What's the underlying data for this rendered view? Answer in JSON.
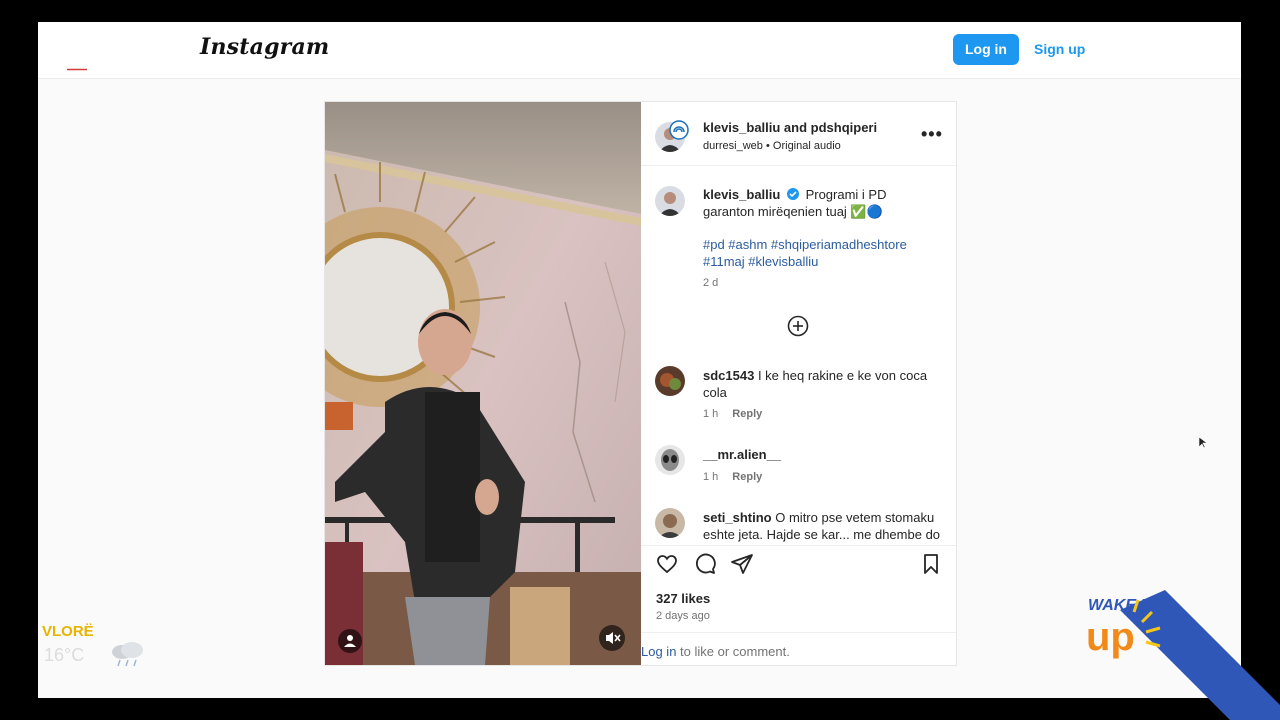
{
  "app": {
    "logo": "Instagram"
  },
  "header": {
    "login_label": "Log in",
    "signup_label": "Sign up"
  },
  "post": {
    "header_user": "klevis_balliu and pdshqiperi",
    "header_subuser": "durresi_web",
    "header_audio": "Original audio",
    "more_label": "•••",
    "caption": {
      "user": "klevis_balliu",
      "text": "Programi i PD garanton mirëqenien tuaj ✅🔵",
      "hashtags": "#pd #ashm #shqiperiamadheshtore #11maj #klevisballiu",
      "time": "2 d"
    },
    "comments": [
      {
        "user": "sdc1543",
        "text": "I ke heq rakine e ke von coca cola",
        "time": "1 h",
        "reply": "Reply"
      },
      {
        "user": "__mr.alien__",
        "text": "",
        "time": "1 h",
        "reply": "Reply"
      },
      {
        "user": "seti_shtino",
        "text": "O mitro pse vetem stomaku eshte jeta. Hajde se kar... me dhembe do"
      }
    ],
    "likes": "327 likes",
    "date": "2 days ago",
    "login_link": "Log in",
    "login_rest": "to like or comment."
  },
  "overlay": {
    "city": "VLORË",
    "temperature": "16°C",
    "brand": "WAKE UP",
    "brand_colors": {
      "blue": "#2f57b8",
      "orange": "#f28a1a",
      "yellow": "#f5c518"
    }
  },
  "colors": {
    "accent_blue": "#1d97ef",
    "link_blue": "#2b5c9e",
    "verified": "#1d97ef"
  }
}
